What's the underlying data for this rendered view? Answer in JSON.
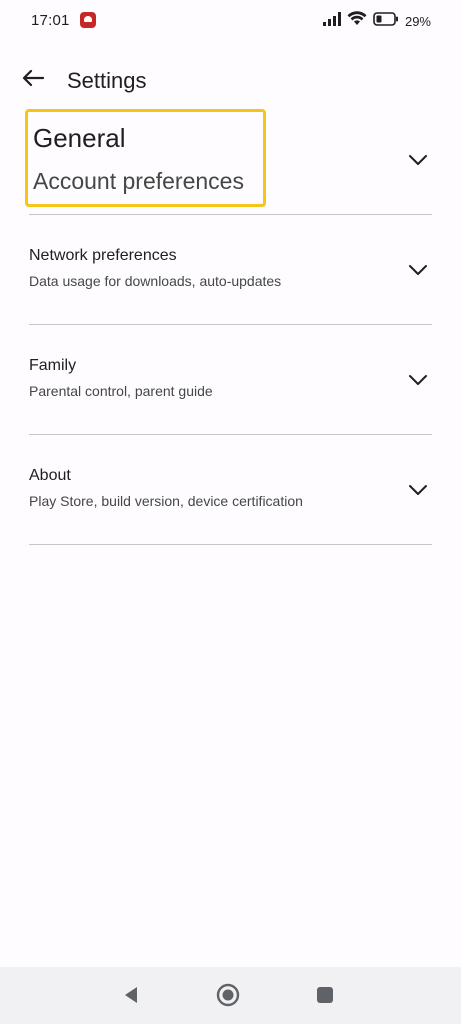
{
  "status_bar": {
    "time": "17:01",
    "battery_text": "29%",
    "icons": [
      "notification-app-icon",
      "signal-icon",
      "wifi-icon",
      "battery-icon"
    ]
  },
  "header": {
    "title": "Settings",
    "back_icon": "arrow-back-icon"
  },
  "settings": {
    "items": [
      {
        "title": "General",
        "subtitle": "Account preferences"
      },
      {
        "title": "Network preferences",
        "subtitle": "Data usage for downloads, auto-updates"
      },
      {
        "title": "Family",
        "subtitle": "Parental control, parent guide"
      },
      {
        "title": "About",
        "subtitle": "Play Store, build version, device certification"
      }
    ]
  },
  "nav_bar": {
    "icons": [
      "back-triangle-icon",
      "home-circle-icon",
      "recents-square-icon"
    ]
  },
  "colors": {
    "highlight": "#f5c518",
    "divider": "#c4c7c5",
    "text_primary": "#1f1f1f",
    "text_secondary": "#444746",
    "status_app_red": "#c62828",
    "nav_background": "#f1f1f4"
  }
}
